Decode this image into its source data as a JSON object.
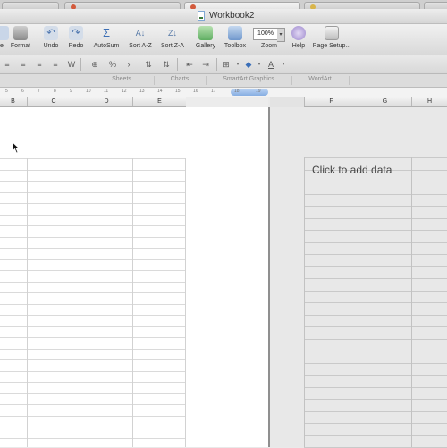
{
  "window": {
    "title": "Workbook2"
  },
  "toolbar": {
    "buttons": [
      {
        "key": "new",
        "label": "e",
        "icon": "new-icon"
      },
      {
        "key": "format",
        "label": "Format",
        "icon": "format-painter-icon"
      },
      {
        "key": "undo",
        "label": "Undo",
        "icon": "undo-icon"
      },
      {
        "key": "redo",
        "label": "Redo",
        "icon": "redo-icon"
      },
      {
        "key": "autosum",
        "label": "AutoSum",
        "icon": "autosum-icon"
      },
      {
        "key": "sort-az",
        "label": "Sort A-Z",
        "icon": "sort-az-icon"
      },
      {
        "key": "sort-za",
        "label": "Sort Z-A",
        "icon": "sort-za-icon"
      },
      {
        "key": "gallery",
        "label": "Gallery",
        "icon": "gallery-icon"
      },
      {
        "key": "toolbox",
        "label": "Toolbox",
        "icon": "toolbox-icon"
      },
      {
        "key": "zoom",
        "label": "Zoom",
        "icon": "zoom-icon"
      },
      {
        "key": "help",
        "label": "Help",
        "icon": "help-icon"
      },
      {
        "key": "page-setup",
        "label": "Page Setup...",
        "icon": "page-setup-icon"
      }
    ],
    "zoom_value": "100%"
  },
  "ribbon": {
    "tabs": [
      "Sheets",
      "Charts",
      "SmartArt Graphics",
      "WordArt"
    ]
  },
  "ruler": {
    "numbers": [
      "5",
      "6",
      "7",
      "8",
      "9",
      "10",
      "11",
      "12",
      "13",
      "14",
      "15",
      "16",
      "17",
      "18",
      "19"
    ]
  },
  "left_columns": [
    "B",
    "C",
    "D",
    "E"
  ],
  "right_columns": [
    "F",
    "G",
    "H"
  ],
  "placeholder": {
    "text": "Click to add data"
  },
  "colors": {
    "accent": "#86aee2",
    "page_divider": "#8f8f8f"
  }
}
